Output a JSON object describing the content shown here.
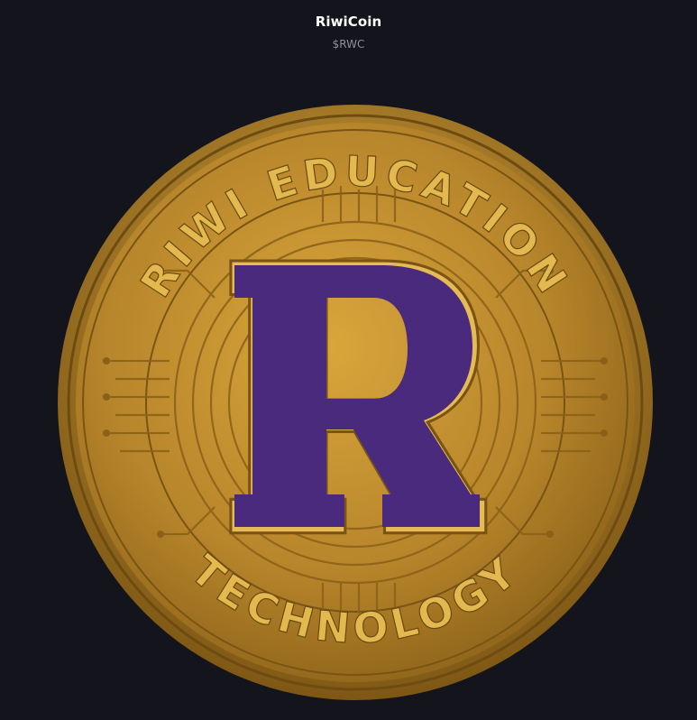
{
  "header": {
    "title": "RiwiCoin",
    "ticker": "$RWC"
  },
  "coin": {
    "top_text": "RIWI  EDUCATION",
    "bottom_text": "TECHNOLOGY",
    "center_letter": "R",
    "colors": {
      "gold_light": "#d8a63a",
      "gold_dark": "#9a6d1c",
      "letter_fill": "#4a2a7c",
      "background": "#14151c"
    }
  }
}
